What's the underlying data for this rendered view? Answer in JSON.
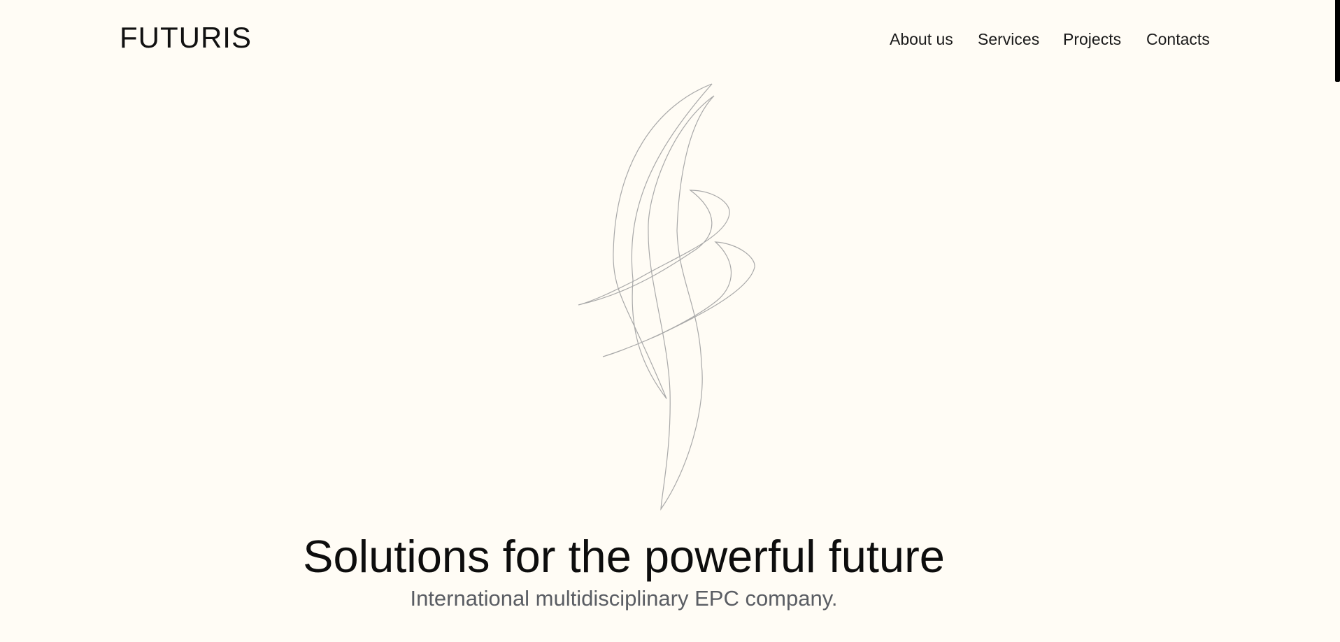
{
  "header": {
    "logo": "FUTURIS",
    "nav": [
      {
        "label": "About us"
      },
      {
        "label": "Services"
      },
      {
        "label": "Projects"
      },
      {
        "label": "Contacts"
      }
    ]
  },
  "hero": {
    "title": "Solutions for the powerful future",
    "subtitle": "International multidisciplinary EPC company.",
    "line_color": "#a9a9a9"
  },
  "colors": {
    "background": "#fffcf5",
    "text": "#111111",
    "subtitle": "#5a5d63"
  }
}
